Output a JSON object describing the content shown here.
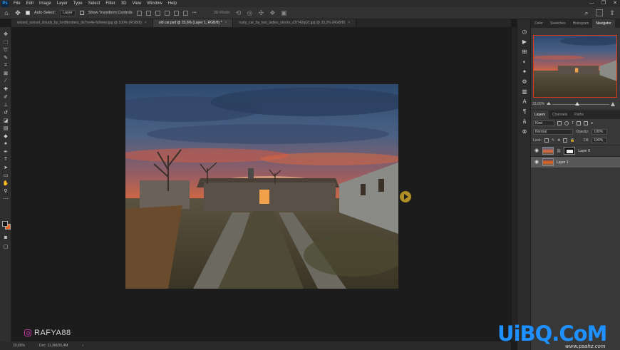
{
  "menubar": {
    "logo": "Ps",
    "items": [
      "File",
      "Edit",
      "Image",
      "Layer",
      "Type",
      "Select",
      "Filter",
      "3D",
      "View",
      "Window",
      "Help"
    ],
    "window_controls": [
      "—",
      "❐",
      "✕"
    ]
  },
  "options_bar": {
    "auto_select_label": "Auto-Select:",
    "auto_select_checked": true,
    "target_value": "Layer",
    "show_transform_label": "Show Transform Controls",
    "show_transform_checked": false,
    "mode_3d_label": "3D Mode:"
  },
  "tabs": [
    {
      "title": "wizard_sunset_clouds_by_lordfrontiers_da7ne4e-fullview.jpg @ 100% (RGB/8)",
      "active": false
    },
    {
      "title": "old car.psd @ 33,6% (Layer 1, RGB/8) *",
      "active": true
    },
    {
      "title": "rusty_car_by_two_ladies_stocks_d1f742q(2).jpg @ 33,3% (RGB/8)",
      "active": false
    }
  ],
  "tools": [
    "move",
    "marquee",
    "lasso",
    "quick-select",
    "crop",
    "frame",
    "eyedropper",
    "healing",
    "brush",
    "stamp",
    "history-brush",
    "eraser",
    "gradient",
    "blur",
    "dodge",
    "pen",
    "type",
    "path-select",
    "shape",
    "hand",
    "zoom",
    "more"
  ],
  "panel_icons": [
    "history",
    "actions",
    "layer-comps",
    "adjustments",
    "styles",
    "properties",
    "libraries",
    "character",
    "paragraph",
    "glyphs",
    "channels"
  ],
  "right_panel": {
    "top_tabs": [
      "Color",
      "Swatches",
      "Histogram",
      "Navigator"
    ],
    "active_top_tab": "Navigator",
    "navigator_zoom": "33,65%",
    "layer_tabs": [
      "Layers",
      "Channels",
      "Paths"
    ],
    "active_layer_tab": "Layers",
    "kind_filter": "Kind",
    "blend_mode": "Normal",
    "opacity_label": "Opacity:",
    "opacity_value": "100%",
    "lock_label": "Lock:",
    "fill_label": "Fill:",
    "fill_value": "100%",
    "layers": [
      {
        "name": "Layer 0",
        "active": false,
        "has_mask": true
      },
      {
        "name": "Layer 1",
        "active": true,
        "has_mask": false
      }
    ]
  },
  "status": {
    "zoom": "33,65%",
    "doc": "Doc: 11,9M/35,4M"
  },
  "watermark": {
    "username": "RAFYA88",
    "site_u": "U",
    "site_i": "i",
    "site_b": "B",
    "site_q": "Q",
    "site_dot": ".",
    "site_com": "CoM",
    "site_sub": "www.psahz.com"
  },
  "colors": {
    "accent_orange": "#e8641c",
    "navigator_frame": "#e03a1e",
    "brand_blue": "#1e90ff"
  }
}
